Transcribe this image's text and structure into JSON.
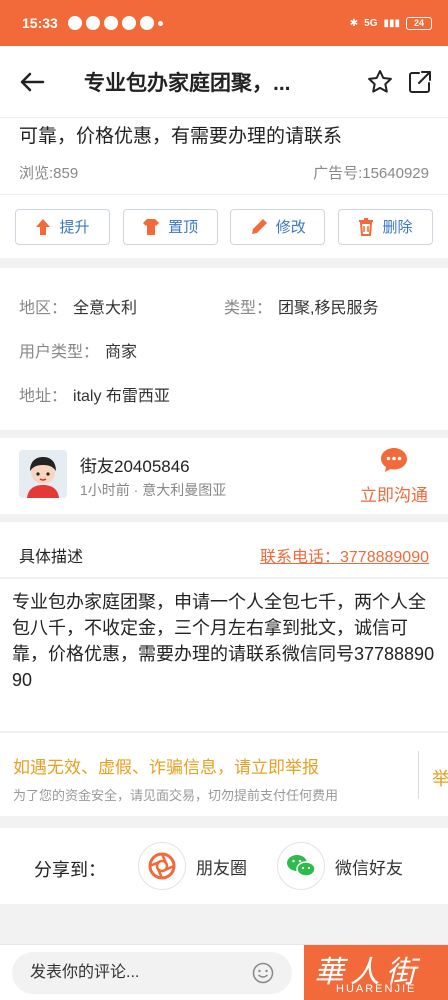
{
  "status_bar": {
    "time": "15:33",
    "network": "5G",
    "battery": "24"
  },
  "nav": {
    "title": "专业包办家庭团聚，..."
  },
  "post": {
    "title_tail": "可靠，价格优惠，有需要办理的请联系",
    "views_label": "浏览:",
    "views": "859",
    "ad_label": "广告号:",
    "ad_number": "15640929"
  },
  "actions": [
    {
      "label": "提升",
      "icon": "arrow-up-icon"
    },
    {
      "label": "置顶",
      "icon": "shirt-icon"
    },
    {
      "label": "修改",
      "icon": "pencil-icon"
    },
    {
      "label": "删除",
      "icon": "trash-icon"
    }
  ],
  "info": {
    "region_label": "地区：",
    "region": "全意大利",
    "type_label": "类型：",
    "type": "团聚,移民服务",
    "user_type_label": "用户类型：",
    "user_type": "商家",
    "address_label": "地址：",
    "address": "italy 布雷西亚"
  },
  "user": {
    "name": "街友20405846",
    "meta": "1小时前 · 意大利曼图亚",
    "chat_label": "立即沟通"
  },
  "description": {
    "label": "具体描述",
    "phone": "联系电话：3778889090",
    "body": "专业包办家庭团聚，申请一个人全包七千，两个人全包八千，不收定金，三个月左右拿到批文，诚信可靠，价格优惠，需要办理的请联系微信同号3778889090"
  },
  "warning": {
    "title": "如遇无效、虚假、诈骗信息，请立即举报",
    "subtitle": "为了您的资金安全，请见面交易，切勿提前支付任何费用",
    "report": "举"
  },
  "share": {
    "label": "分享到：",
    "moments": "朋友圈",
    "wechat": "微信好友"
  },
  "comment": {
    "placeholder": "发表你的评论...",
    "logo_text": "華人街",
    "logo_sub": "HUARENJIE"
  },
  "colors": {
    "brand": "#f26a3a",
    "link": "#3a78c3",
    "warning": "#e8a020"
  }
}
